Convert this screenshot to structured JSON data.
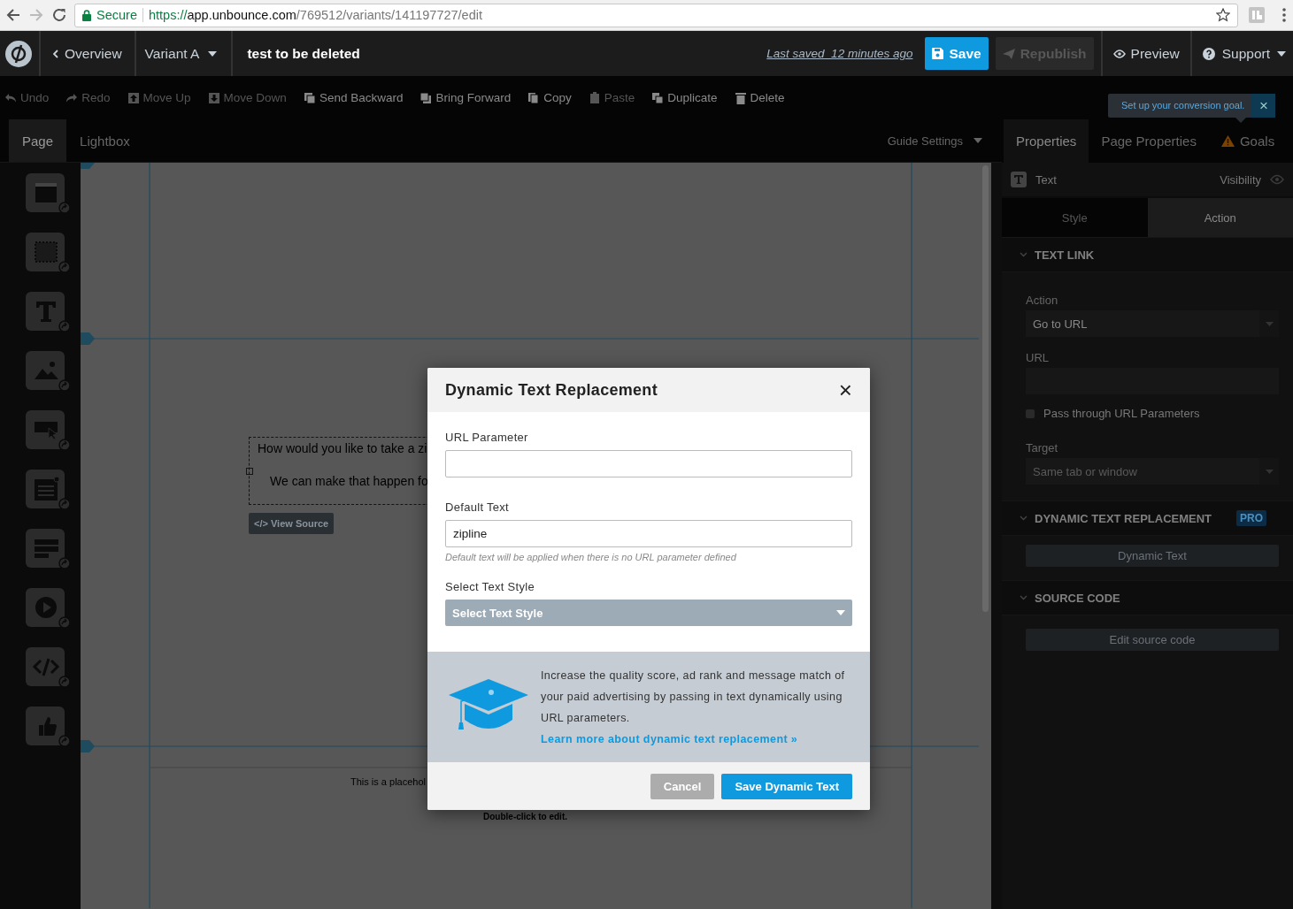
{
  "browser": {
    "secure_label": "Secure",
    "url_scheme": "https://",
    "url_host": "app.unbounce.com",
    "url_path": "/769512/variants/141197727/edit"
  },
  "header": {
    "back_label": "Overview",
    "variant": "Variant A",
    "page_title": "test to be deleted",
    "last_saved": "Last saved  12 minutes ago",
    "buttons": [
      {
        "label": "Save",
        "disabled": false
      },
      {
        "label": "Republish",
        "disabled": true
      }
    ],
    "preview": "Preview",
    "support": "Support"
  },
  "toolbar": [
    {
      "label": "Undo",
      "disabled": true
    },
    {
      "label": "Redo",
      "disabled": true
    },
    {
      "label": "Move Up",
      "disabled": true
    },
    {
      "label": "Move Down",
      "disabled": true
    },
    {
      "label": "Send Backward",
      "disabled": false
    },
    {
      "label": "Bring Forward",
      "disabled": false
    },
    {
      "label": "Copy",
      "disabled": false
    },
    {
      "label": "Paste",
      "disabled": true
    },
    {
      "label": "Duplicate",
      "disabled": false
    },
    {
      "label": "Delete",
      "disabled": false
    }
  ],
  "tooltip": {
    "text": "Set up your conversion goal.",
    "close": "×"
  },
  "canvas_tabs": [
    {
      "label": "Page",
      "selected": true
    },
    {
      "label": "Lightbox",
      "selected": false
    }
  ],
  "guide_settings": "Guide Settings",
  "canvas": {
    "text_line_1": "How would you like to take a zi",
    "text_line_2": "We can make that happen fo",
    "view_source": "</> View Source",
    "placeholder_text": "This is a placehol",
    "edit_hint": "Double-click to edit."
  },
  "panel": {
    "tabs": [
      {
        "label": "Properties",
        "selected": true,
        "warning": false
      },
      {
        "label": "Page Properties",
        "selected": false,
        "warning": false
      },
      {
        "label": "Goals",
        "selected": false,
        "warning": true
      }
    ],
    "element": "Text",
    "visibility": "Visibility",
    "subtabs": [
      {
        "label": "Style",
        "selected": false
      },
      {
        "label": "Action",
        "selected": true
      }
    ],
    "text_link": {
      "title": "TEXT LINK",
      "action_label": "Action",
      "action_value": "Go to URL",
      "url_label": "URL",
      "pass_through": {
        "label": "Pass through URL Parameters",
        "checked": false
      },
      "target_label": "Target",
      "target_value": "Same tab or window",
      "target_disabled": true
    },
    "dtr": {
      "title": "DYNAMIC TEXT REPLACEMENT",
      "badge": "PRO",
      "button": "Dynamic Text"
    },
    "source": {
      "title": "SOURCE CODE",
      "button": "Edit source code"
    }
  },
  "modal": {
    "title": "Dynamic Text Replacement",
    "close": "×",
    "fields": [
      {
        "label": "URL Parameter"
      },
      {
        "label": "Default Text",
        "value": "zipline",
        "hint": "Default text will be applied when there is no URL parameter defined"
      }
    ],
    "style_label": "Select Text Style",
    "style_select": "Select Text Style",
    "info": "Increase the quality score, ad rank and message match of your paid advertising by passing in text dynamically using URL parameters.",
    "info_link": "Learn more about dynamic text replacement »",
    "buttons": [
      {
        "label": "Cancel",
        "kind": "secondary"
      },
      {
        "label": "Save Dynamic Text",
        "kind": "primary"
      }
    ]
  }
}
